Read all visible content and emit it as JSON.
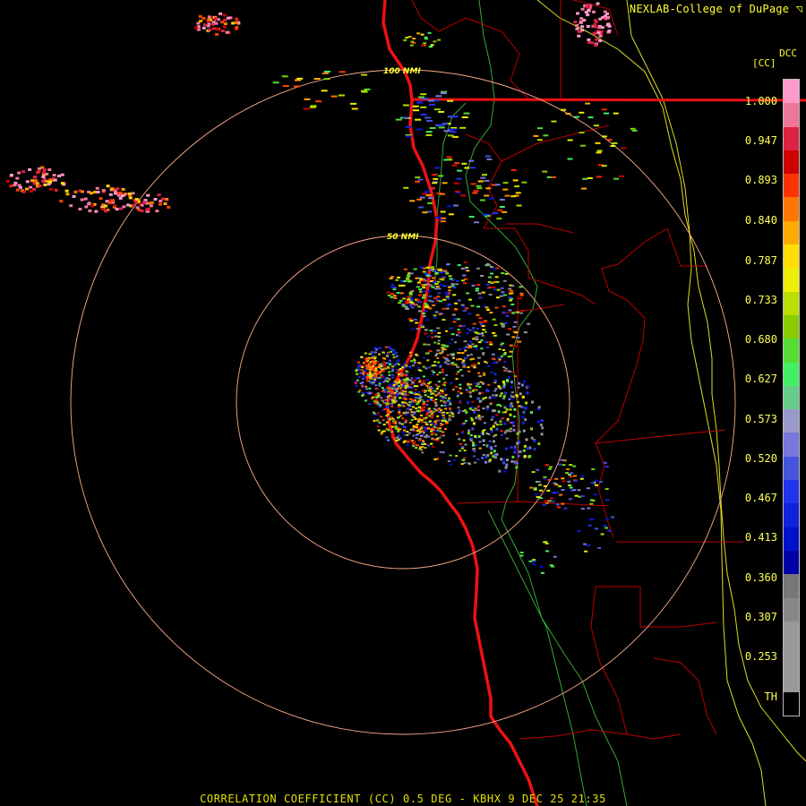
{
  "header": {
    "credit": "NEXLAB-College of DuPage"
  },
  "footer": {
    "caption": "CORRELATION COEFFICIENT (CC) 0.5 DEG - KBHX 9 DEC 25 21:35"
  },
  "legend": {
    "code": "DCC",
    "unit": "[CC]",
    "labels": [
      "1.000",
      "0.947",
      "0.893",
      "0.840",
      "0.787",
      "0.733",
      "0.680",
      "0.627",
      "0.573",
      "0.520",
      "0.467",
      "0.413",
      "0.360",
      "0.307",
      "0.253",
      "TH"
    ],
    "colors": [
      "#ff99cc",
      "#ee7799",
      "#dd2244",
      "#cc0000",
      "#ff3300",
      "#ff7700",
      "#ffaa00",
      "#ffdd00",
      "#eeee00",
      "#bbdd00",
      "#88cc00",
      "#55dd33",
      "#44ee66",
      "#66cc88",
      "#9999cc",
      "#7777dd",
      "#4455dd",
      "#2233ee",
      "#1122dd",
      "#0011cc",
      "#0000aa",
      "#777777",
      "#888888",
      "#999999",
      "#999999",
      "#999999",
      "#000000"
    ]
  },
  "map": {
    "range_rings": [
      "50 NMI",
      "100 NMI"
    ],
    "colors": {
      "background": "#000000",
      "range_ring": "#ff9966",
      "coast": "#ff2222",
      "county": "#cc0000",
      "road": "#33cc33",
      "state_line": "#ffff33"
    }
  }
}
